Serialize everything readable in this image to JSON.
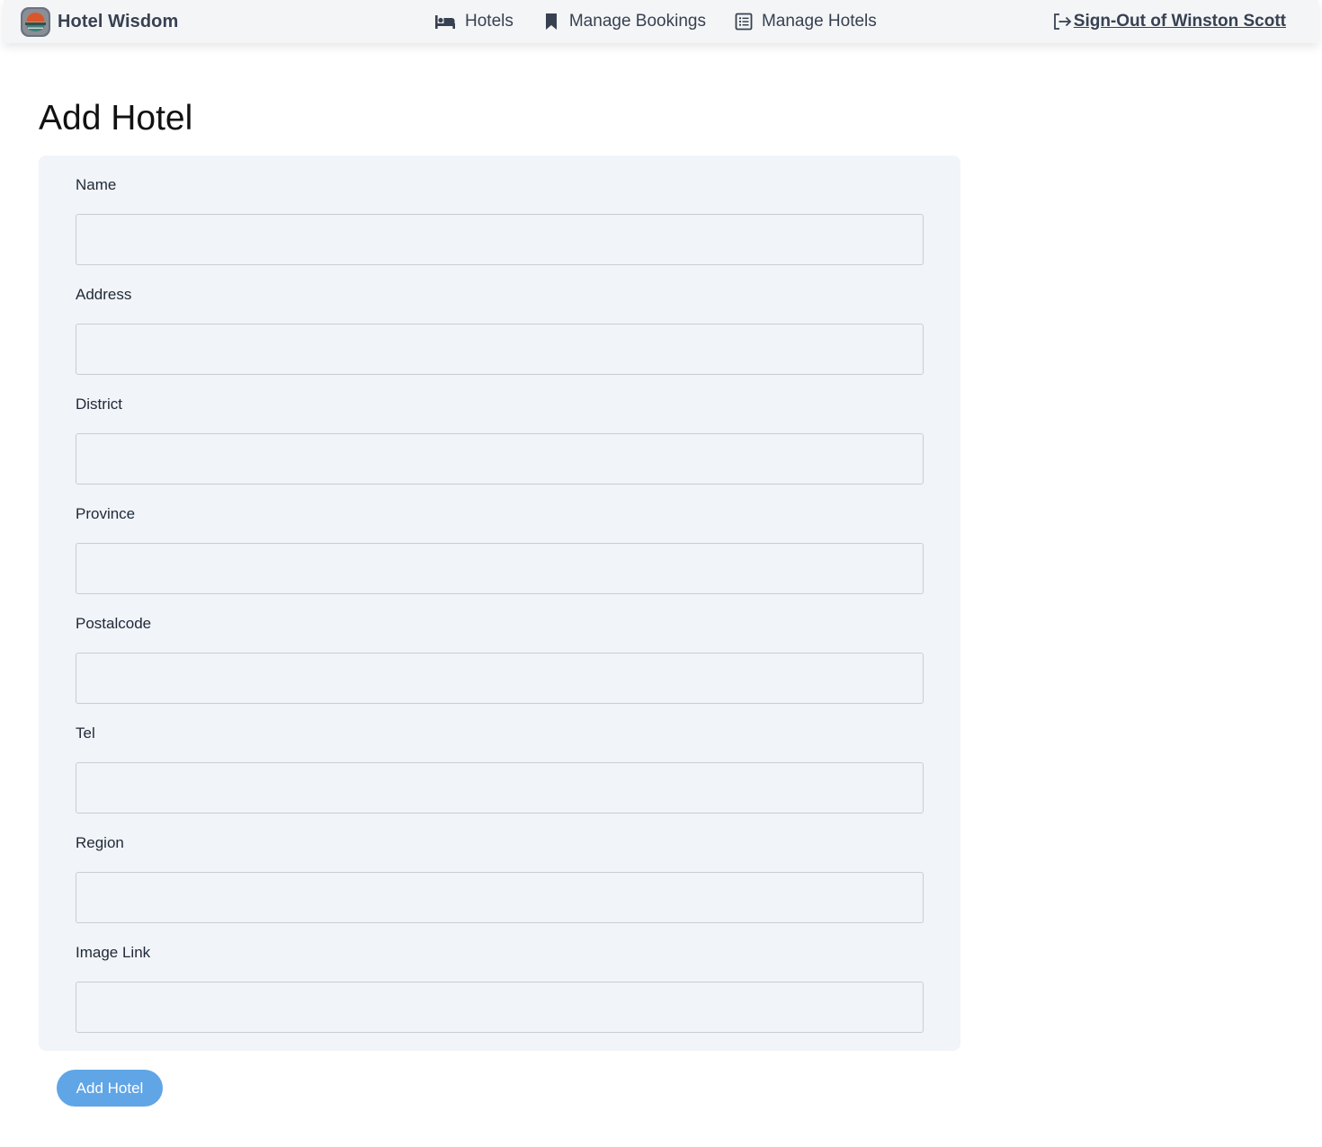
{
  "navbar": {
    "brand_name": "Hotel Wisdom",
    "logo_icon": "sunset-logo-icon",
    "links": [
      {
        "label": "Hotels",
        "icon": "bed-icon"
      },
      {
        "label": "Manage Bookings",
        "icon": "bookmark-icon"
      },
      {
        "label": "Manage Hotels",
        "icon": "list-icon"
      }
    ],
    "signout": {
      "label": "Sign-Out of Winston Scott",
      "icon": "sign-out-icon"
    }
  },
  "page": {
    "title": "Add Hotel"
  },
  "form": {
    "fields": [
      {
        "label": "Name",
        "value": "",
        "placeholder": ""
      },
      {
        "label": "Address",
        "value": "",
        "placeholder": ""
      },
      {
        "label": "District",
        "value": "",
        "placeholder": ""
      },
      {
        "label": "Province",
        "value": "",
        "placeholder": ""
      },
      {
        "label": "Postalcode",
        "value": "",
        "placeholder": ""
      },
      {
        "label": "Tel",
        "value": "",
        "placeholder": ""
      },
      {
        "label": "Region",
        "value": "",
        "placeholder": ""
      },
      {
        "label": "Image Link",
        "value": "",
        "placeholder": ""
      }
    ],
    "submit_label": "Add Hotel"
  },
  "colors": {
    "navbar_bg": "#f4f5f7",
    "panel_bg": "#f1f4f8",
    "button_bg": "#60a5e6",
    "text": "#374151"
  }
}
